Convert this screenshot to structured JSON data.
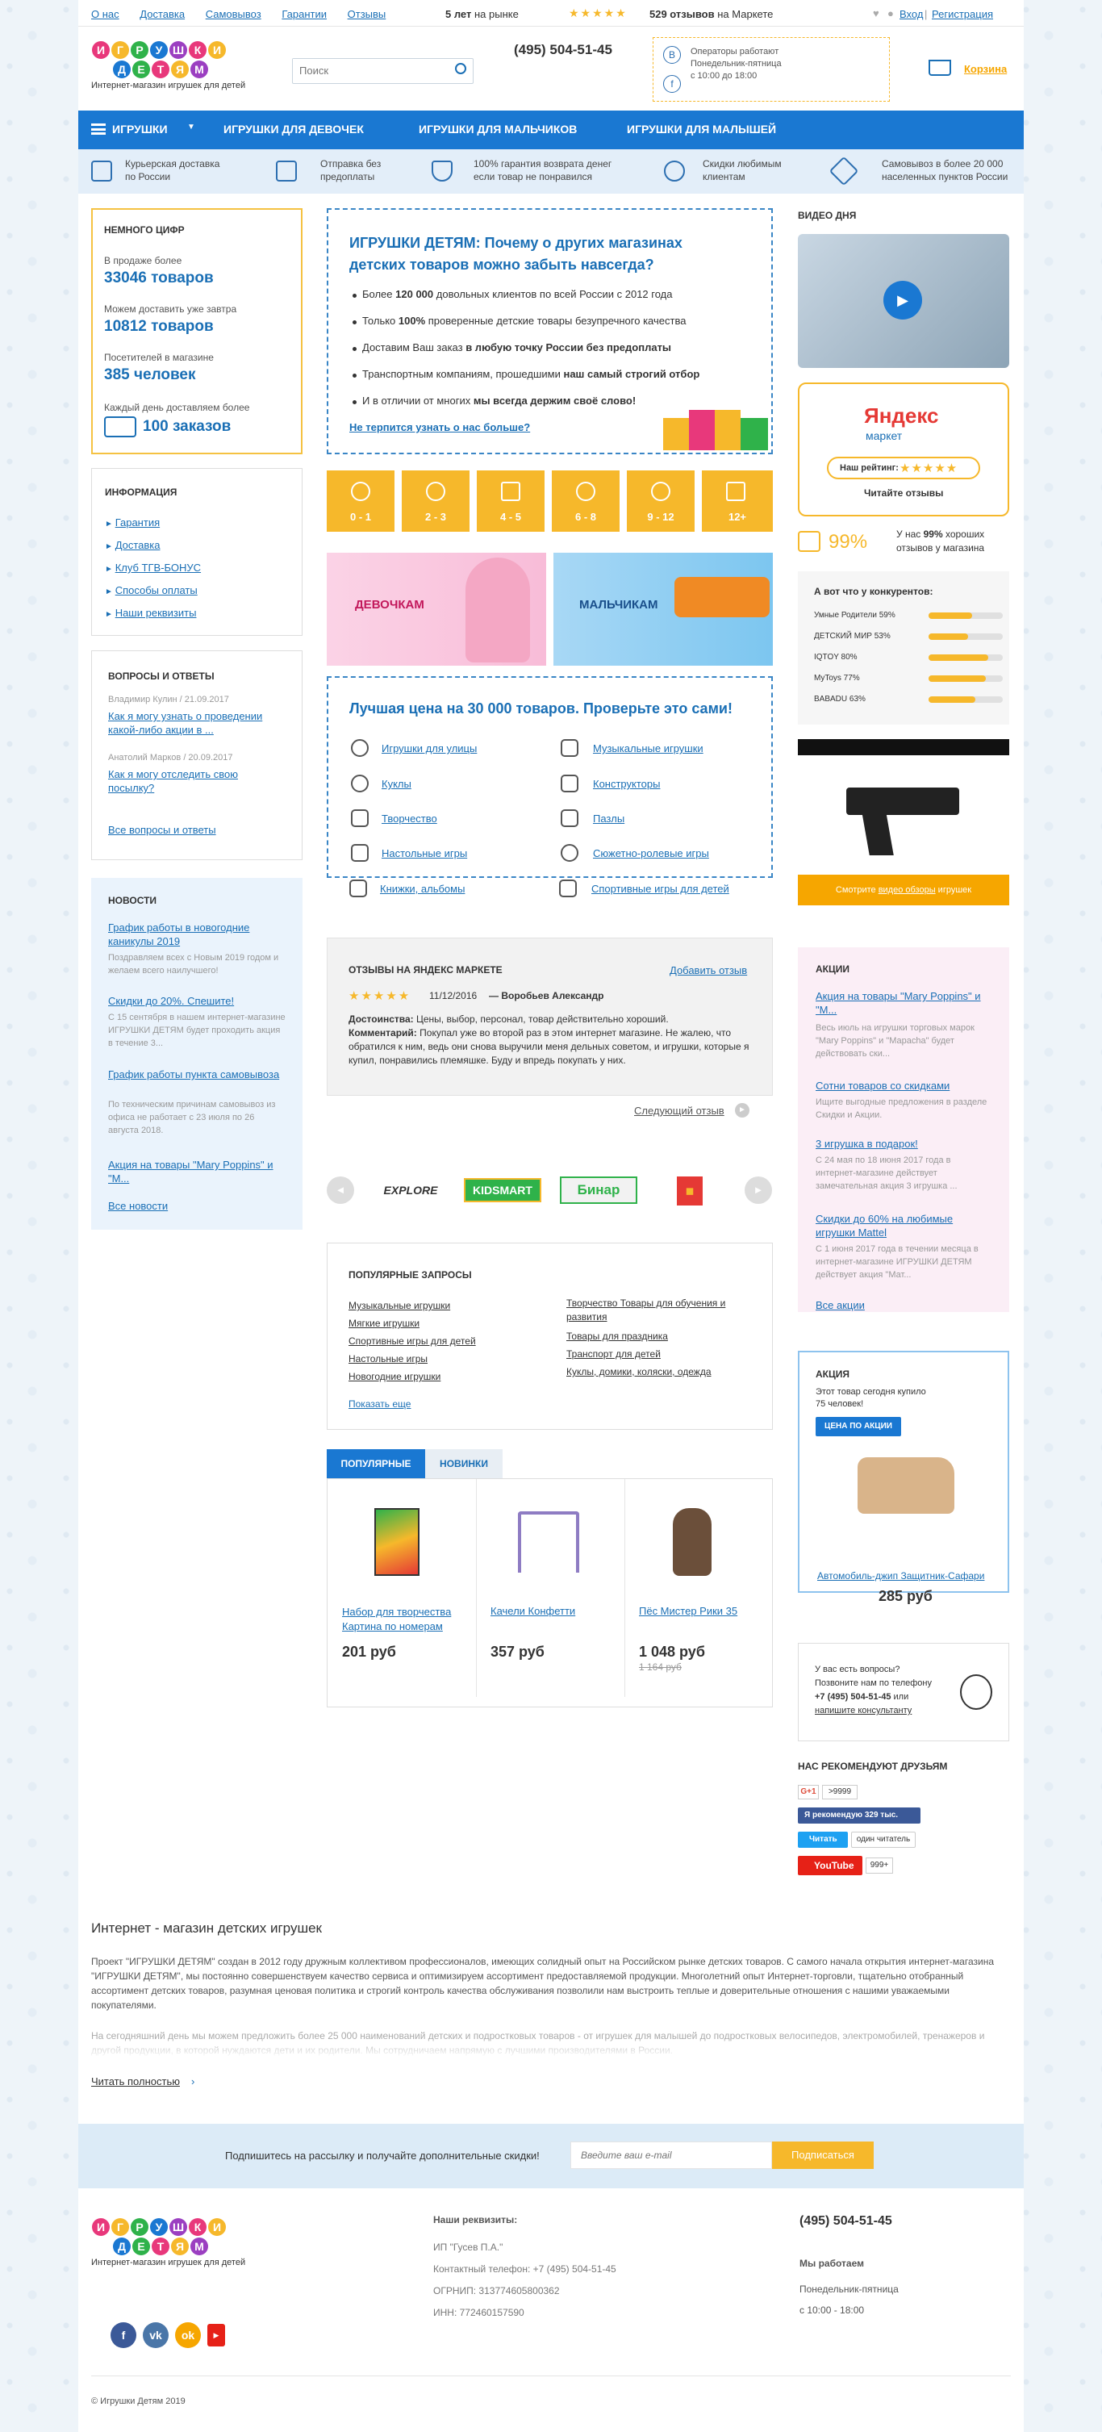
{
  "topnav": {
    "links": [
      "О нас",
      "Доставка",
      "Самовывоз",
      "Гарантии",
      "Отзывы"
    ],
    "years_bold": "5 лет",
    "years_rest": "на рынке",
    "reviews_bold": "529 отзывов",
    "reviews_rest": "на Маркете",
    "login": "Вход",
    "register": "Регистрация"
  },
  "header": {
    "logo_line1": "ИГРУШКИ",
    "logo_line2": "ДЕТЯМ",
    "logo_sub": "Интернет-магазин игрушек для детей",
    "search_placeholder": "Поиск",
    "phone": "(495) 504-51-45",
    "operators": [
      "Операторы работают",
      "Понедельник-пятница",
      "с 10:00 до 18:00"
    ],
    "cart": "Корзина"
  },
  "menu": {
    "items": [
      "ИГРУШКИ",
      "ИГРУШКИ ДЛЯ ДЕВОЧЕК",
      "ИГРУШКИ ДЛЯ МАЛЬЧИКОВ",
      "ИГРУШКИ ДЛЯ МАЛЫШЕЙ"
    ]
  },
  "features": [
    [
      "Курьерская доставка",
      "по России"
    ],
    [
      "Отправка без",
      "предоплаты"
    ],
    [
      "100% гарантия возврата денег",
      "если товар не понравился"
    ],
    [
      "Скидки любимым",
      "клиентам"
    ],
    [
      "Самовывоз в более 20 000",
      "населенных пунктов России"
    ]
  ],
  "numbers": {
    "title": "НЕМНОГО ЦИФР",
    "items": [
      {
        "label": "В продаже более",
        "value": "33046 товаров"
      },
      {
        "label": "Можем доставить уже завтра",
        "value": "10812 товаров"
      },
      {
        "label": "Посетителей в магазине",
        "value": "385 человек"
      }
    ],
    "daily_label": "Каждый день доставляем более",
    "daily_value": "100 заказов"
  },
  "info": {
    "title": "ИНФОРМАЦИЯ",
    "links": [
      "Гарантия",
      "Доставка",
      "Клуб ТГВ-БОНУС",
      "Способы оплаты",
      "Наши реквизиты"
    ]
  },
  "qa": {
    "title": "ВОПРОСЫ И ОТВЕТЫ",
    "items": [
      {
        "meta": "Владимир Кулин / 21.09.2017",
        "q": "Как я могу узнать о проведении какой-либо акции в ..."
      },
      {
        "meta": "Анатолий Марков / 20.09.2017",
        "q": "Как я могу отследить свою посылку?"
      }
    ],
    "all": "Все вопросы и ответы"
  },
  "news": {
    "title": "НОВОСТИ",
    "items": [
      {
        "t": "График работы в новогодние каникулы 2019",
        "d": "Поздравляем всех с Новым 2019 годом и желаем всего наилучшего!"
      },
      {
        "t": "Скидки до 20%. Спешите!",
        "d": "С 15 сентября в нашем интернет-магазине ИГРУШКИ ДЕТЯМ будет проходить акция в течение 3..."
      },
      {
        "t": "График работы пункта самовывоза",
        "d": "По техническим причинам самовывоз из офиса не работает с 23 июля по 26 августа 2018."
      },
      {
        "t": "Акция на товары \"Mary Poppins\" и \"М...",
        "d": ""
      }
    ],
    "all": "Все новости"
  },
  "why": {
    "title": "ИГРУШКИ ДЕТЯМ: Почему о других магазинах детских товаров можно забыть навсегда?",
    "b1a": "Более ",
    "b1b": "120 000",
    "b1c": " довольных клиентов по всей России с 2012 года",
    "b2a": "Только ",
    "b2b": "100%",
    "b2c": " проверенные детские товары безупречного качества",
    "b3a": "Доставим Ваш заказ ",
    "b3b": "в любую точку России без предоплаты",
    "b4a": "Транспортным компаниям, прошедшими ",
    "b4b": "наш самый строгий отбор",
    "b5a": "И в отличии от многих ",
    "b5b": "мы всегда держим своё слово!",
    "link": "Не терпится узнать о нас больше?"
  },
  "ages": [
    "0 - 1",
    "2 - 3",
    "4 - 5",
    "6 - 8",
    "9 - 12",
    "12+"
  ],
  "banners": {
    "girls": "ДЕВОЧКАМ",
    "boys": "МАЛЬЧИКАМ"
  },
  "bestprice": {
    "title": "Лучшая цена на 30 000 товаров. Проверьте это сами!",
    "cats": [
      "Игрушки для улицы",
      "Музыкальные игрушки",
      "Куклы",
      "Конструкторы",
      "Творчество",
      "Пазлы",
      "Настольные игры",
      "Сюжетно-ролевые игры",
      "Книжки, альбомы",
      "Спортивные игры для детей"
    ]
  },
  "reviews": {
    "title": "ОТЗЫВЫ НА ЯНДЕКС МАРКЕТЕ",
    "add": "Добавить отзыв",
    "stars": "★★★★★",
    "date": "11/12/2016",
    "author": "— Воробьев Александр",
    "adv_label": "Достоинства:",
    "adv": " Цены, выбор, персонал, товар действительно хороший.",
    "com_label": "Комментарий:",
    "com": " Покупал уже во второй раз в этом интернет магазине. Не жалею, что обратился к ним, ведь они снова выручили меня дельных советом, и игрушки, которые я купил, понравились племяшке. Буду и впредь покупать у них.",
    "next": "Следующий отзыв"
  },
  "brands": [
    "EXPLORE",
    "KIDSMART",
    "Бинар",
    "◼"
  ],
  "popular": {
    "title": "ПОПУЛЯРНЫЕ ЗАПРОСЫ",
    "left": [
      "Музыкальные игрушки",
      "Мягкие игрушки",
      "Спортивные игры для детей",
      "Настольные игры",
      "Новогодние игрушки"
    ],
    "right": [
      "Творчество Товары для обучения и развития",
      "Товары для праздника",
      "Транспорт для детей",
      "Куклы, домики, коляски, одежда"
    ],
    "more": "Показать еще"
  },
  "tabs": [
    "ПОПУЛЯРНЫЕ",
    "НОВИНКИ"
  ],
  "products": [
    {
      "name": "Набор для творчества Картина по номерам",
      "price": "201 руб",
      "old": ""
    },
    {
      "name": "Качели Конфетти",
      "price": "357 руб",
      "old": ""
    },
    {
      "name": "Пёс Мистер Рики 35",
      "price": "1 048 руб",
      "old": "1 164 руб"
    }
  ],
  "right": {
    "video_title": "ВИДЕО ДНЯ",
    "ym_title": "Яндекс",
    "ym_sub": "маркет",
    "ym_rating": "Наш рейтинг:",
    "ym_stars": "★★★★★",
    "ym_read": "Читайте  отзывы",
    "percent": "99%",
    "percent_text_a": "У нас ",
    "percent_text_b": "99%",
    "percent_text_c": " хороших отзывов у магазина",
    "comp_title": "А вот что у конкурентов:",
    "competitors": [
      {
        "n": "Умные Родители 59%",
        "v": 59
      },
      {
        "n": "ДЕТСКИЙ МИР 53%",
        "v": 53
      },
      {
        "n": "IQTOY 80%",
        "v": 80
      },
      {
        "n": "MyToys 77%",
        "v": 77
      },
      {
        "n": "BABADU 63%",
        "v": 63
      }
    ],
    "video2_cap_a": "Смотрите ",
    "video2_cap_b": "видео обзоры",
    "video2_cap_c": " игрушек",
    "promo_title": "АКЦИИ",
    "promos": [
      {
        "t": "Акция на товары \"Mary Poppins\" и \"М...",
        "d": "Весь июль на игрушки торговых марок \"Mary Poppins\" и \"Мараcha\" будет действовать ски..."
      },
      {
        "t": "Сотни товаров со скидками",
        "d": "Ищите выгодные предложения в разделе Скидки и Акции."
      },
      {
        "t": "3 игрушка в подарок!",
        "d": "С 24 мая по 18 июня 2017 года в интернет-магазине действует замечательная акция 3 игрушка ..."
      },
      {
        "t": "Скидки до 60% на любимые игрушки Mattel",
        "d": "С 1 июня 2017 года в течении месяца в интернет-магазине ИГРУШКИ ДЕТЯМ действует акция \"Мат..."
      }
    ],
    "promo_all": "Все акции",
    "deal_title": "АКЦИЯ",
    "deal_text": "Этот товар сегодня купило 75 человек!",
    "deal_btn": "ЦЕНА ПО АКЦИИ",
    "deal_name": "Автомобиль-джип Защитник-Сафари",
    "deal_price": "285 руб",
    "q_lines": [
      "У вас есть вопросы?",
      "Позвоните нам по телефону"
    ],
    "q_phone": "+7 (495) 504-51-45",
    "q_or": " или",
    "q_link": "напишите консультанту",
    "friends_title": "НАС РЕКОМЕНДУЮТ ДРУЗЬЯМ",
    "gplus": "G+1",
    "gcount": ">9999",
    "fb": "Я рекомендую 329 тыс.",
    "tw": "Читать",
    "tw_count": "один читатель",
    "yt": "YouTube",
    "yt_count": "999+"
  },
  "about": {
    "title": "Интернет - магазин детских игрушек",
    "p1": "Проект \"ИГРУШКИ ДЕТЯМ\" создан в 2012 году дружным коллективом профессионалов, имеющих солидный опыт на Российском рынке детских товаров. С самого начала открытия интернет-магазина \"ИГРУШКИ ДЕТЯМ\", мы постоянно совершенствуем качество сервиса и оптимизируем ассортимент предоставляемой продукции. Многолетний опыт Интернет-торговли, тщательно отобранный ассортимент детских товаров, разумная ценовая политика и строгий контроль качества обслуживания позволили нам выстроить теплые и доверительные отношения с нашими уважаемыми покупателями.",
    "p2": "На сегодняшний день мы можем предложить более 25 000 наименований детских и подростковых товаров - от игрушек для малышей до подростковых велосипедов, электромобилей, тренажеров и другой продукции, в которой нуждаются дети и их родители. Мы сотрудничаем напрямую с лучшими производителями в России.",
    "more": "Читать полностью"
  },
  "subscribe": {
    "text": "Подпишитесь на рассылку и получайте дополнительные скидки!",
    "placeholder": "Введите ваш e-mail",
    "btn": "Подписаться"
  },
  "footer": {
    "req_title": "Наши реквизиты:",
    "req": [
      "ИП \"Гусев П.А.\"",
      "Контактный телефон: +7 (495) 504-51-45",
      "ОГРНИП: 313774605800362",
      "ИНН: 772460157590"
    ],
    "phone": "(495) 504-51-45",
    "work_title": "Мы работаем",
    "work": [
      "Понедельник-пятница",
      "с 10:00 - 18:00"
    ],
    "copyright": "© Игрушки Детям 2019"
  }
}
